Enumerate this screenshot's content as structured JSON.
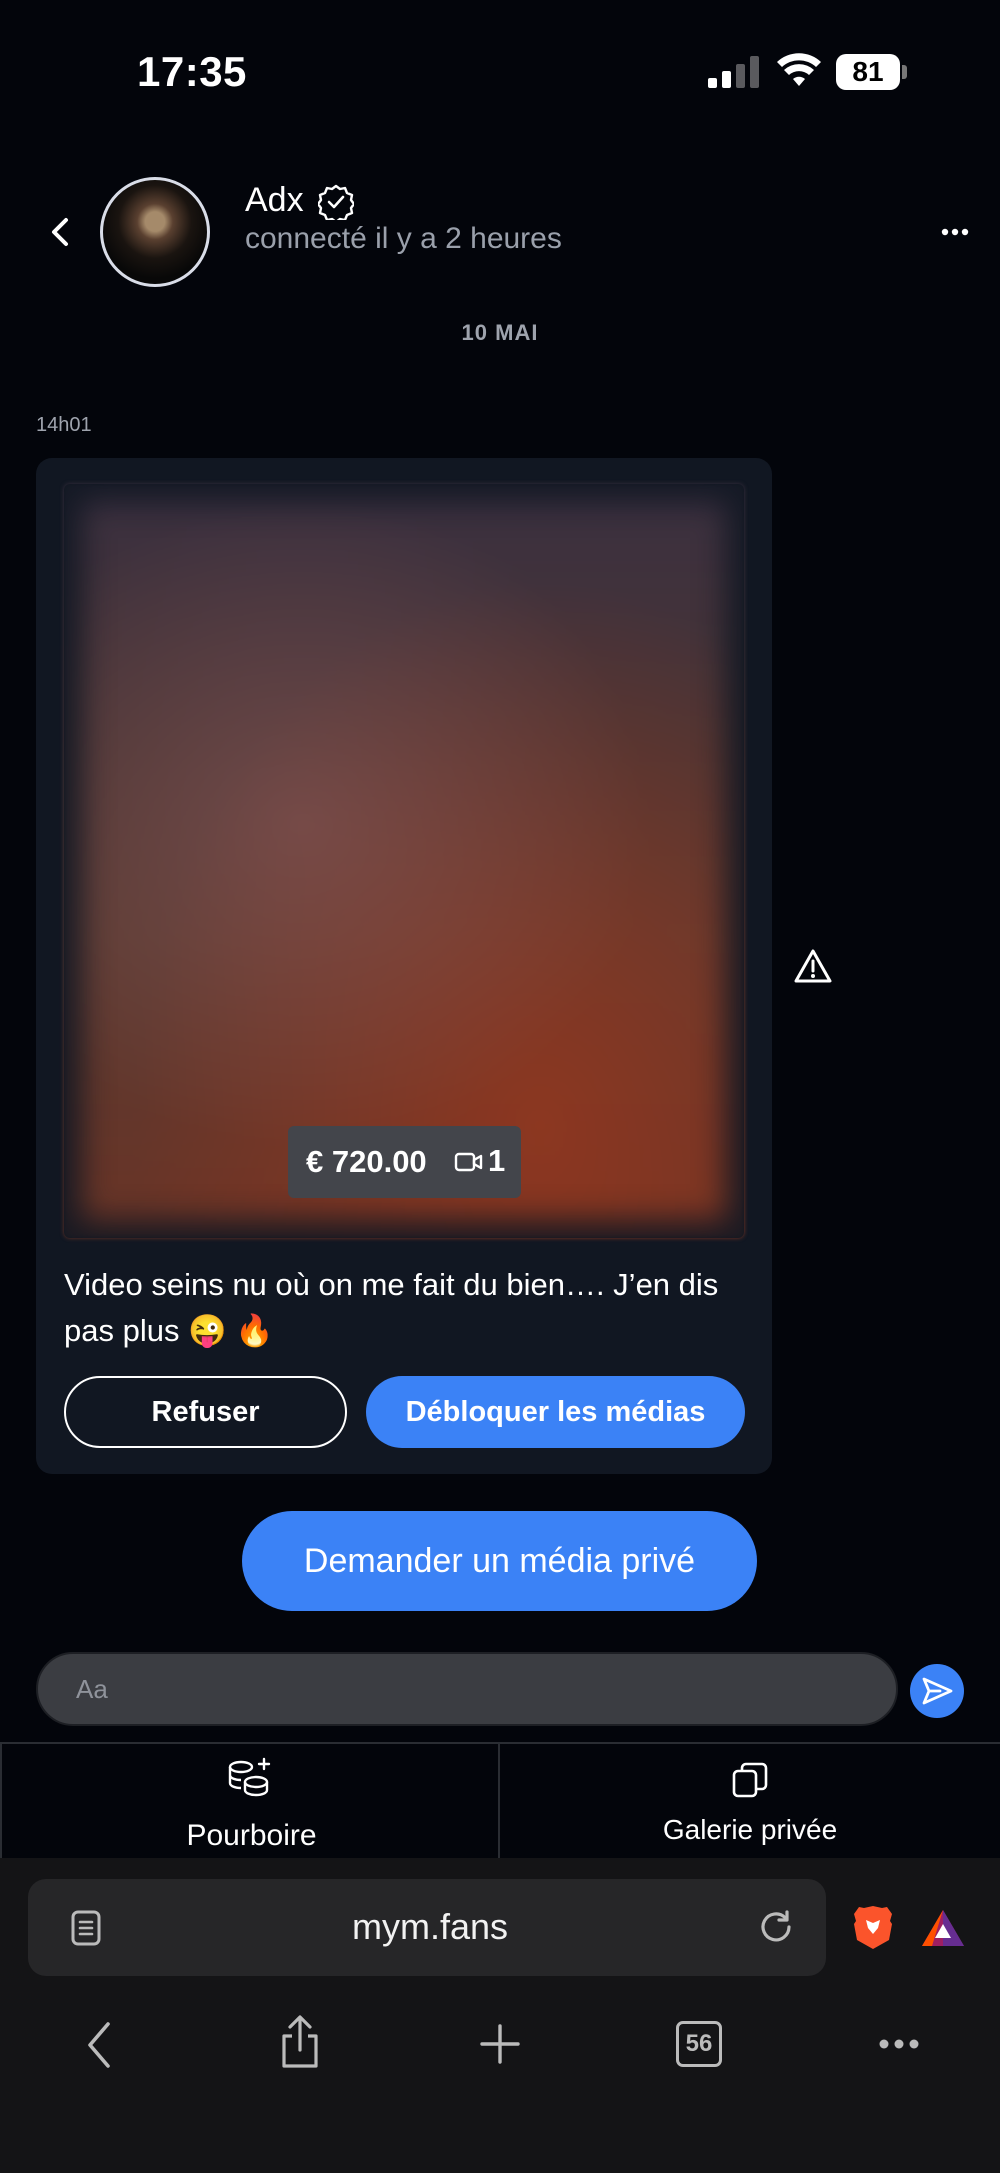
{
  "status_bar": {
    "time": "17:35",
    "battery": "81"
  },
  "header": {
    "name": "Adx",
    "status": "connecté il y a 2 heures"
  },
  "conversation": {
    "date_separator": "10 MAI",
    "message": {
      "time": "14h01",
      "price": "€ 720.00",
      "media_count": "1",
      "caption": "Video seins nu où on me fait du bien…. J’en dis pas plus 😜 🔥",
      "refuse_label": "Refuser",
      "unlock_label": "Débloquer les médias"
    },
    "request_label": "Demander un média privé"
  },
  "composer": {
    "placeholder": "Aa"
  },
  "action_bar": {
    "tip_label": "Pourboire",
    "gallery_label": "Galerie privée"
  },
  "browser": {
    "url": "mym.fans",
    "tab_count": "56"
  },
  "colors": {
    "accent": "#3b82f6",
    "background": "#03050b",
    "card": "#111722"
  }
}
